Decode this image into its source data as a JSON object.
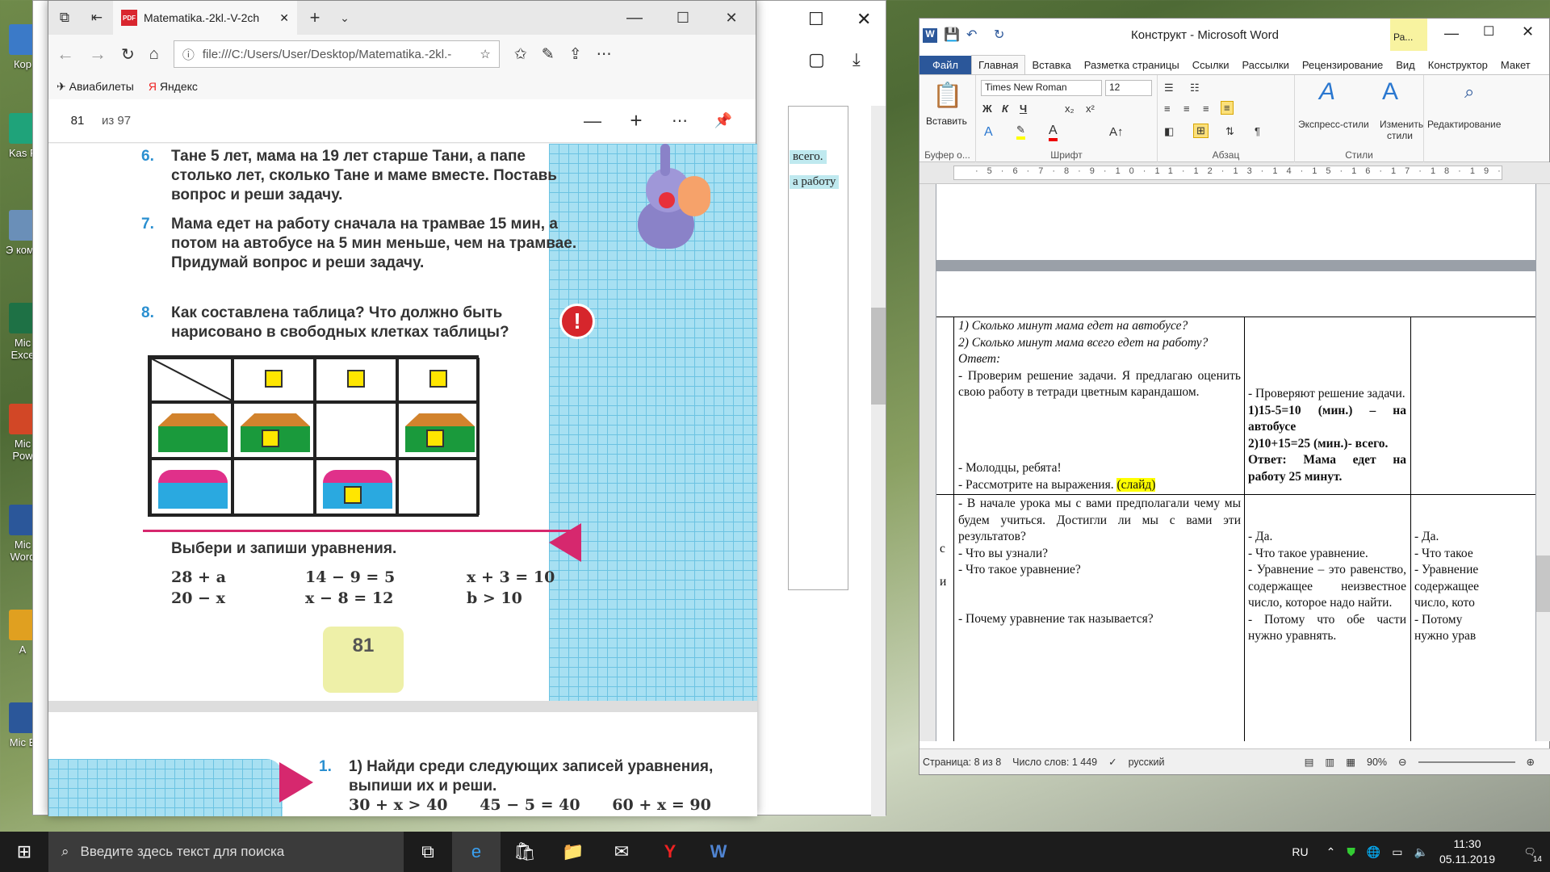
{
  "desktop": {
    "icons": [
      {
        "label": "Кор"
      },
      {
        "label": "Kas F"
      },
      {
        "label": "Э комп"
      },
      {
        "label": "Mic Exce"
      },
      {
        "label": "Mic Pow"
      },
      {
        "label": "Mic Word"
      },
      {
        "label": "A"
      },
      {
        "label": "Mic E"
      }
    ]
  },
  "edge": {
    "tab_title": "Matematika.-2kl.-V-2ch",
    "url": "file:///C:/Users/User/Desktop/Matematika.-2kl.-",
    "favorites": [
      "Авиабилеты",
      "Яндекс"
    ],
    "pdf_page": "81",
    "pdf_total": "из 97",
    "tasks": [
      {
        "n": "6.",
        "text": "Тане 5 лет, мама на 19 лет старше Тани, а папе столько лет, сколько Тане и маме вместе. Поставь вопрос и реши задачу."
      },
      {
        "n": "7.",
        "text": "Мама едет на работу сначала на трамвае 15 мин, а потом на автобусе на 5 мин меньше, чем на трамвае.",
        "text2": "Придумай вопрос и реши задачу."
      },
      {
        "n": "8.",
        "text": "Как составлена таблица? Что должно быть нарисовано в свободных клетках таблицы?"
      }
    ],
    "choose": "Выбери и запиши уравнения.",
    "expressions": [
      "28 + a",
      "20 − x",
      "14 − 9 = 5",
      "x − 8 = 12",
      "x + 3 = 10",
      "b > 10"
    ],
    "page_number": "81",
    "next_task_n": "1.",
    "next_task": "1) Найди среди следующих записей уравнения, выпиши их и реши.",
    "next_exprs": "30 + x > 40      45 − 5 = 40      60 + x = 90"
  },
  "background_window": {
    "snippets": [
      "всего.",
      "а работу"
    ]
  },
  "word": {
    "title": "Конструкт - Microsoft Word",
    "ctx_tab": "Ра...",
    "tabs": [
      "Файл",
      "Главная",
      "Вставка",
      "Разметка страницы",
      "Ссылки",
      "Рассылки",
      "Рецензирование",
      "Вид",
      "Конструктор",
      "Макет"
    ],
    "font": "Times New Roman",
    "size": "12",
    "groups": {
      "clipboard": "Буфер о...",
      "font": "Шрифт",
      "paragraph": "Абзац",
      "styles": "Стили"
    },
    "buttons": {
      "paste": "Вставить",
      "quick_styles": "Экспресс-стили",
      "change_styles": "Изменить стили",
      "editing": "Редактирование"
    },
    "cells": {
      "teacher1": [
        "1) Сколько минут мама едет на автобусе?",
        "2) Сколько минут мама всего едет на работу?",
        "Ответ:",
        "- Проверим решение задачи. Я предлагаю оценить свою работу в тетради цветным карандашом."
      ],
      "teacher1b": [
        "- Молодцы, ребята!",
        "- Рассмотрите на выражения.",
        "(слайд)"
      ],
      "pupils1": [
        "- Проверяют решение задачи.",
        "1)15-5=10 (мин.) – на автобусе",
        "2)10+15=25 (мин.)- всего.",
        "Ответ: Мама едет на работу 25 минут."
      ],
      "teacher2": [
        "- В начале урока мы с вами предполагали чему мы будем учиться. Достигли ли мы с вами эти результатов?",
        "- Что вы узнали?",
        "- Что такое уравнение?"
      ],
      "teacher2b": "- Почему уравнение так называется?",
      "pupils2": [
        "- Да.",
        "- Что такое уравнение.",
        "- Уравнение – это равенство, содержащее неизвестное число, которое надо найти.",
        "- Потому что обе части нужно уравнять."
      ],
      "col3": [
        "- Да.",
        "- Что такое",
        "- Уравнение",
        "содержащее",
        "число, кото",
        "- Потому",
        "нужно урав"
      ],
      "left_col": [
        "с",
        "и"
      ]
    },
    "status": {
      "page": "Страница: 8 из 8",
      "words": "Число слов: 1 449",
      "lang": "русский",
      "zoom": "90%"
    }
  },
  "taskbar": {
    "search": "Введите здесь текст для поиска",
    "lang": "RU",
    "time": "11:30",
    "date": "05.11.2019",
    "notif": "14"
  }
}
